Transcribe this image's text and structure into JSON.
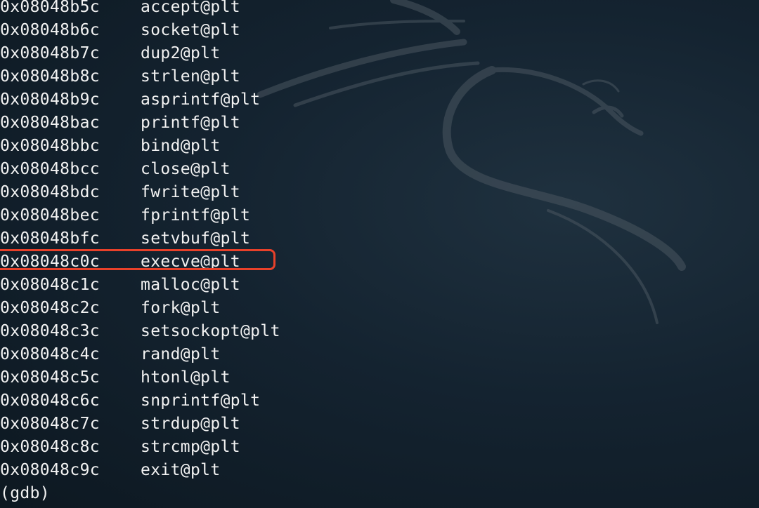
{
  "terminal": {
    "entries": [
      {
        "address": "0x08048b5c",
        "symbol": "accept@plt"
      },
      {
        "address": "0x08048b6c",
        "symbol": "socket@plt"
      },
      {
        "address": "0x08048b7c",
        "symbol": "dup2@plt"
      },
      {
        "address": "0x08048b8c",
        "symbol": "strlen@plt"
      },
      {
        "address": "0x08048b9c",
        "symbol": "asprintf@plt"
      },
      {
        "address": "0x08048bac",
        "symbol": "printf@plt"
      },
      {
        "address": "0x08048bbc",
        "symbol": "bind@plt"
      },
      {
        "address": "0x08048bcc",
        "symbol": "close@plt"
      },
      {
        "address": "0x08048bdc",
        "symbol": "fwrite@plt"
      },
      {
        "address": "0x08048bec",
        "symbol": "fprintf@plt"
      },
      {
        "address": "0x08048bfc",
        "symbol": "setvbuf@plt"
      },
      {
        "address": "0x08048c0c",
        "symbol": "execve@plt"
      },
      {
        "address": "0x08048c1c",
        "symbol": "malloc@plt"
      },
      {
        "address": "0x08048c2c",
        "symbol": "fork@plt"
      },
      {
        "address": "0x08048c3c",
        "symbol": "setsockopt@plt"
      },
      {
        "address": "0x08048c4c",
        "symbol": "rand@plt"
      },
      {
        "address": "0x08048c5c",
        "symbol": "htonl@plt"
      },
      {
        "address": "0x08048c6c",
        "symbol": "snprintf@plt"
      },
      {
        "address": "0x08048c7c",
        "symbol": "strdup@plt"
      },
      {
        "address": "0x08048c8c",
        "symbol": "strcmp@plt"
      },
      {
        "address": "0x08048c9c",
        "symbol": "exit@plt"
      }
    ],
    "prompt": "(gdb)"
  },
  "colors": {
    "background": "#142330",
    "text": "#f2f2f2",
    "highlight_border": "#e8412a"
  },
  "wallpaper": {
    "icon": "kali-dragon-icon"
  }
}
